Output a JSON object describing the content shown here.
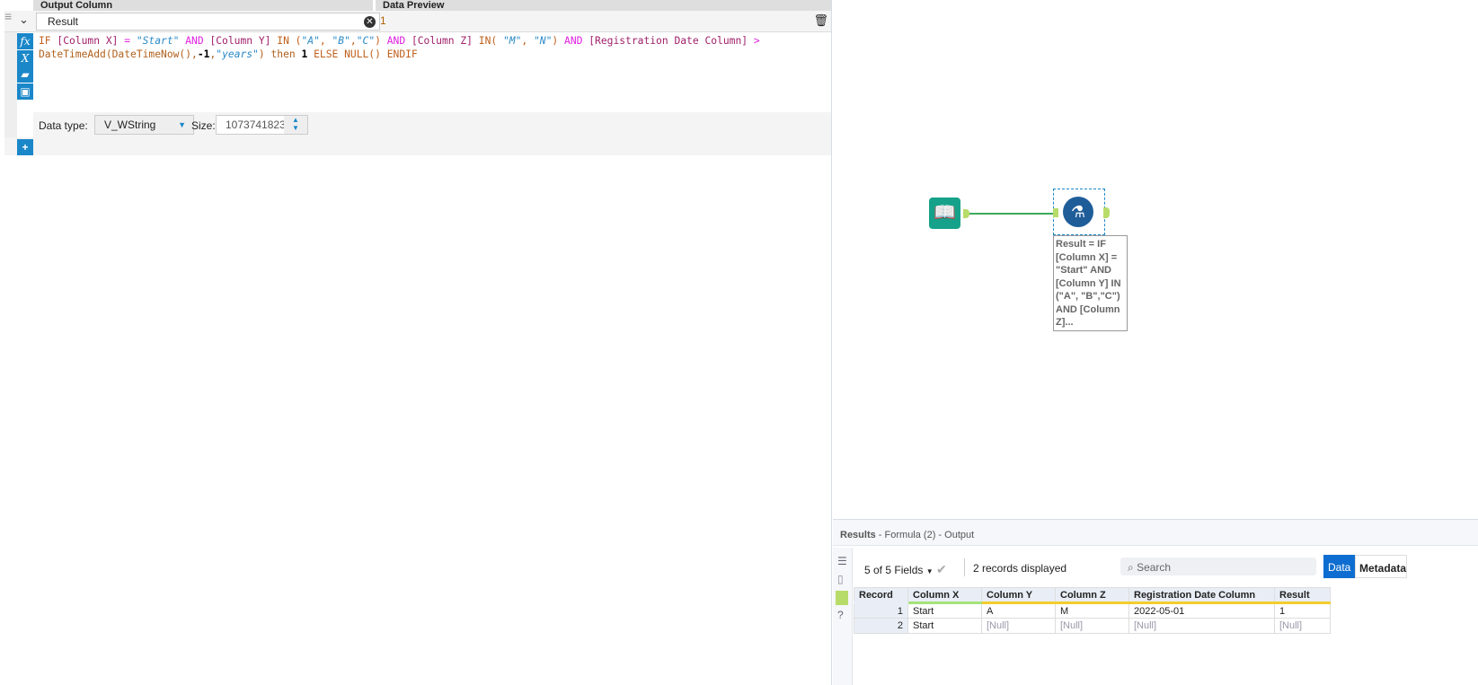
{
  "formula": {
    "header_output_column": "Output Column",
    "header_data_preview": "Data Preview",
    "column_name": "Result",
    "preview_value": "1",
    "expression_tokens": [
      [
        "kw",
        "IF "
      ],
      [
        "fld",
        "[Column X]"
      ],
      [
        "and",
        " = "
      ],
      [
        "str",
        "\"Start\""
      ],
      [
        "and",
        " AND "
      ],
      [
        "fld",
        "[Column Y]"
      ],
      [
        "kw",
        " IN ("
      ],
      [
        "str",
        "\"A\""
      ],
      [
        "kw",
        ", "
      ],
      [
        "str",
        "\"B\""
      ],
      [
        "kw",
        ","
      ],
      [
        "str",
        "\"C\""
      ],
      [
        "kw",
        ")"
      ],
      [
        "and",
        " AND "
      ],
      [
        "fld",
        "[Column Z]"
      ],
      [
        "kw",
        " IN( "
      ],
      [
        "str",
        "\"M\""
      ],
      [
        "kw",
        ", "
      ],
      [
        "str",
        "\"N\""
      ],
      [
        "kw",
        ")"
      ],
      [
        "and",
        " AND "
      ],
      [
        "fld",
        "[Registration Date Column]"
      ],
      [
        "and",
        " >\n"
      ],
      [
        "fn",
        "DateTimeAdd(DateTimeNow(),"
      ],
      [
        "num",
        "-1"
      ],
      [
        "fn",
        ","
      ],
      [
        "str",
        "\"years\""
      ],
      [
        "fn",
        ") then "
      ],
      [
        "num",
        "1"
      ],
      [
        "kw",
        " ELSE NULL() ENDIF"
      ]
    ],
    "data_type_label": "Data type:",
    "data_type_value": "V_WString",
    "size_label": "Size:",
    "size_value": "1073741823"
  },
  "canvas": {
    "tool_annotation": "Result = IF [Column X] = \"Start\" AND [Column Y] IN (\"A\", \"B\",\"C\") AND [Column Z]..."
  },
  "results": {
    "title": "Results",
    "subtitle": " - Formula (2) - Output",
    "fields_selector": "5 of 5 Fields",
    "records_displayed": "2 records displayed",
    "search_placeholder": "Search",
    "tab_data": "Data",
    "tab_metadata": "Metadata",
    "columns": [
      "Record",
      "Column X",
      "Column Y",
      "Column Z",
      "Registration Date Column",
      "Result"
    ],
    "rows": [
      [
        "1",
        "Start",
        "A",
        "M",
        "2022-05-01",
        "1"
      ],
      [
        "2",
        "Start",
        "[Null]",
        "[Null]",
        "[Null]",
        "[Null]"
      ]
    ]
  }
}
